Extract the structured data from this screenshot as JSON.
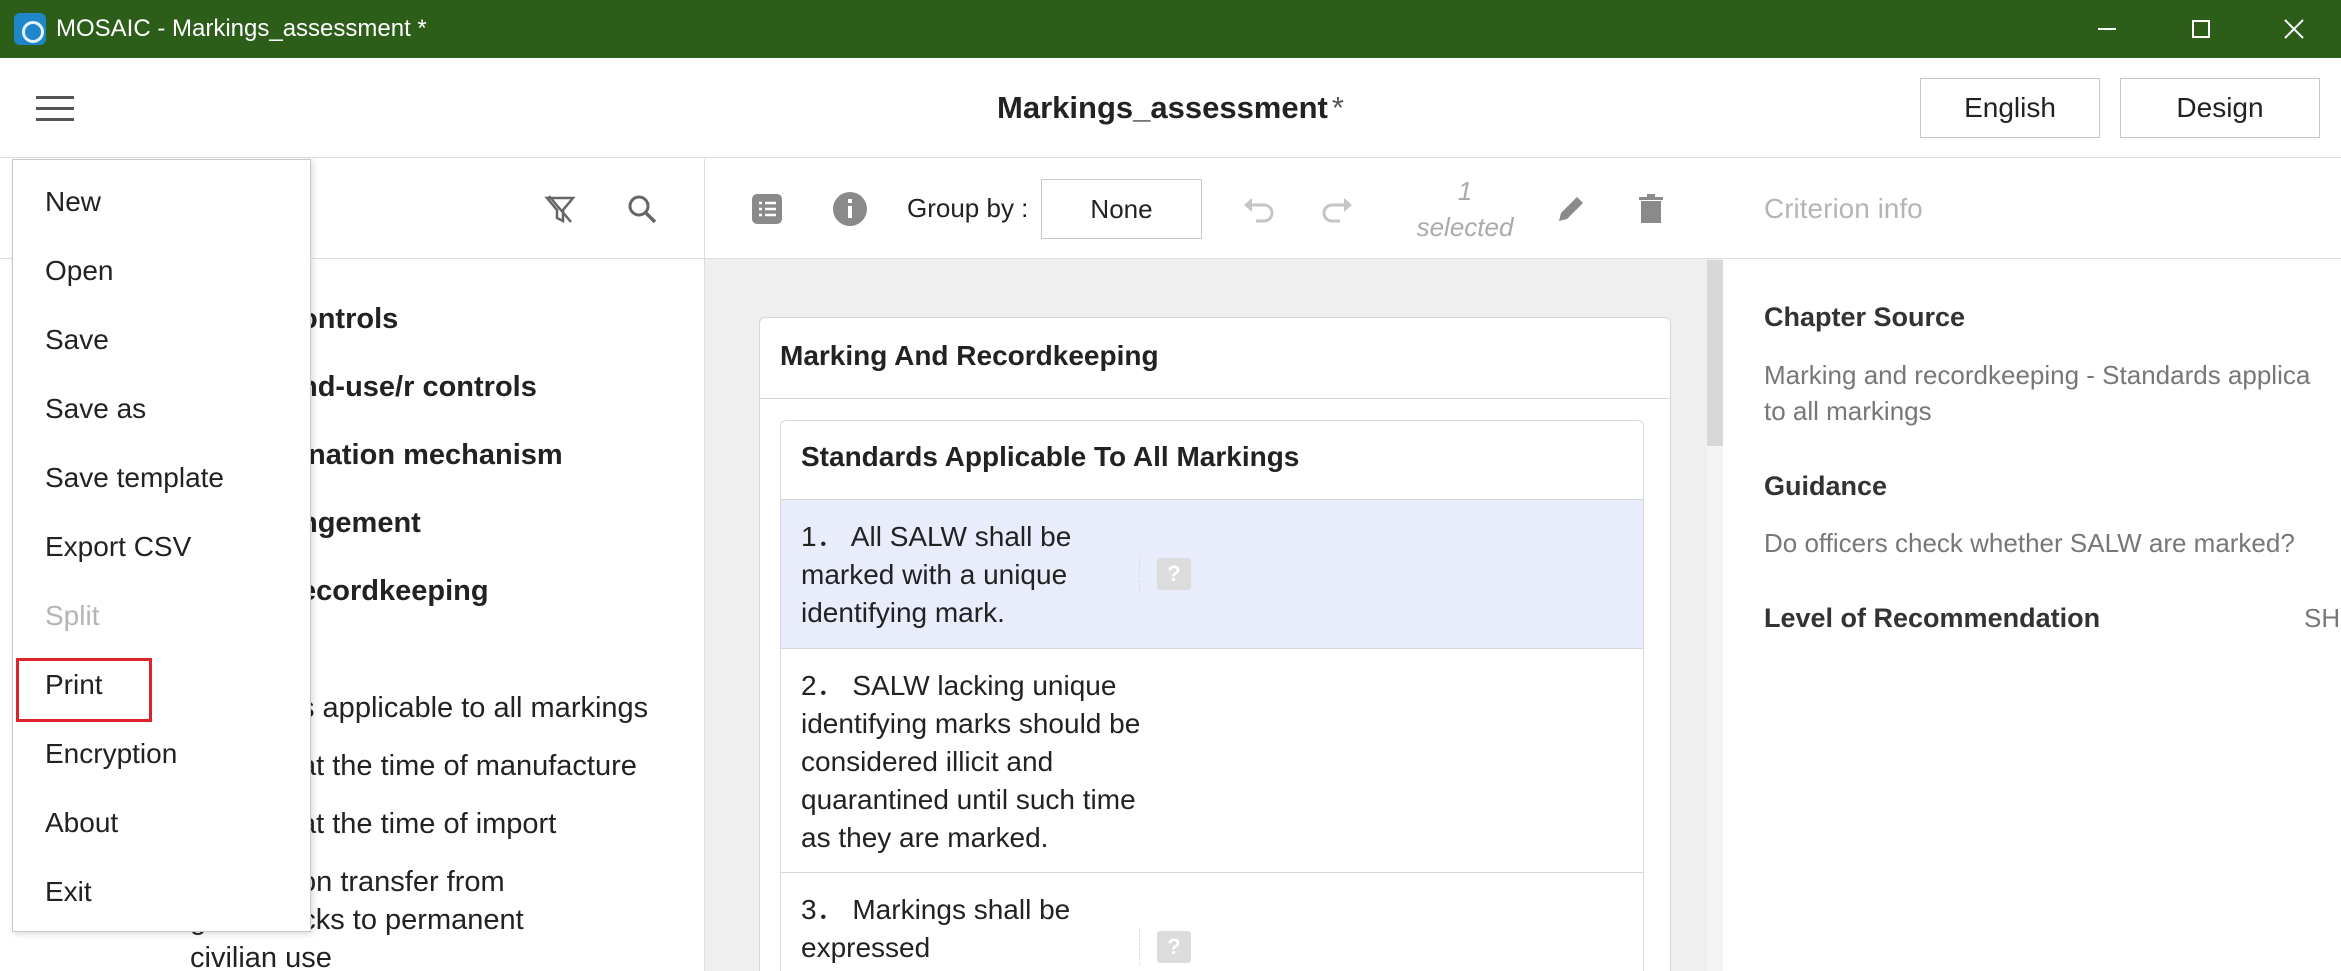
{
  "window": {
    "title": "MOSAIC - Markings_assessment *"
  },
  "header": {
    "doc_title": "Markings_assessment",
    "modified": "*",
    "language": "English",
    "mode": "Design"
  },
  "left": {
    "tree": [
      "ontrols",
      "nd-use/r controls",
      "ination mechanism",
      "ngement",
      "ecordkeeping"
    ],
    "sub": [
      "s applicable to all markings",
      "at the time of manufacture",
      "at the time of import",
      "on transfer from",
      "g        ent stocks to permanent",
      "civilian use"
    ]
  },
  "menu": {
    "items": [
      "New",
      "Open",
      "Save",
      "Save as",
      "Save template",
      "Export CSV",
      "Split",
      "Print",
      "Encryption",
      "About",
      "Exit"
    ]
  },
  "center": {
    "group_label": "Group by :",
    "group_value": "None",
    "selected_count": "1",
    "selected_label": "selected",
    "section_title": "Marking And Recordkeeping",
    "subsection_title": "Standards Applicable To All Markings",
    "criteria": [
      "1． All SALW shall be marked with a unique identifying mark.",
      "2． SALW lacking unique identifying marks should be considered illicit and quarantined until such time as they are marked.",
      "3． Markings shall be expressed"
    ],
    "qmark": "?"
  },
  "right": {
    "title": "Criterion info",
    "chapter_label": "Chapter Source",
    "chapter_text_1": "Marking and recordkeeping - Standards applica",
    "chapter_text_2": "to all markings",
    "guidance_label": "Guidance",
    "guidance_text": "Do officers check whether SALW are marked?",
    "level_label": "Level of Recommendation",
    "level_value": "SH"
  },
  "colors": {
    "titlebar": "#2c5e1a",
    "selection": "#e8ecfb",
    "highlight": "#e0232a"
  }
}
